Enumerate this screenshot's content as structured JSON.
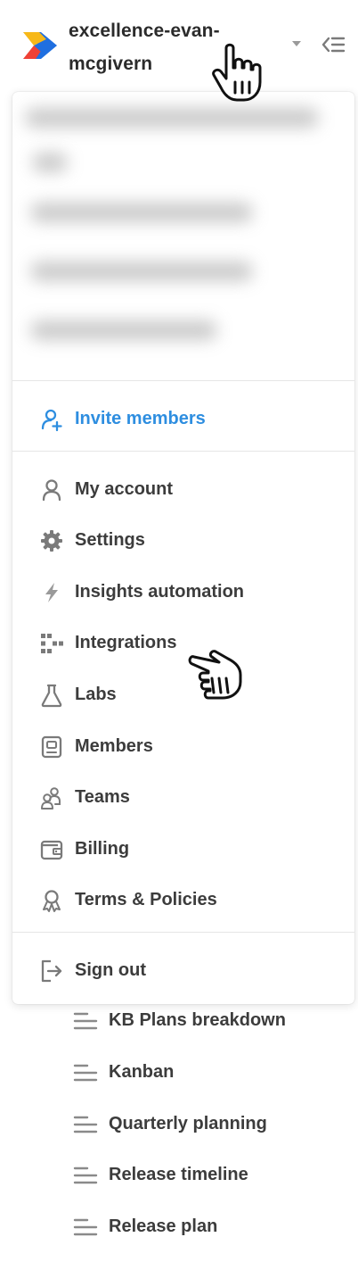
{
  "workspace": {
    "name": "excellence-evan-mcgivern"
  },
  "menu": {
    "invite_label": "Invite members",
    "items": [
      {
        "label": "My account",
        "icon": "user-icon"
      },
      {
        "label": "Settings",
        "icon": "gear-icon"
      },
      {
        "label": "Insights automation",
        "icon": "lightning-icon"
      },
      {
        "label": "Integrations",
        "icon": "integrations-icon"
      },
      {
        "label": "Labs",
        "icon": "flask-icon"
      },
      {
        "label": "Members",
        "icon": "members-icon"
      },
      {
        "label": "Teams",
        "icon": "teams-icon"
      },
      {
        "label": "Billing",
        "icon": "wallet-icon"
      },
      {
        "label": "Terms & Policies",
        "icon": "ribbon-icon"
      }
    ],
    "signout_label": "Sign out"
  },
  "views": [
    {
      "label": "KB Plans breakdown",
      "icon": "list-icon"
    },
    {
      "label": "Kanban",
      "icon": "list-icon"
    },
    {
      "label": "Quarterly planning",
      "icon": "list-icon"
    },
    {
      "label": "Release timeline",
      "icon": "list-icon"
    },
    {
      "label": "Release plan",
      "icon": "list-icon"
    }
  ],
  "colors": {
    "accent": "#2e8ee0",
    "text": "#3c3c3c",
    "icon": "#7a7a7a",
    "logo_blue": "#1f6fe0",
    "logo_red": "#ef4136",
    "logo_yellow": "#f7b818"
  }
}
